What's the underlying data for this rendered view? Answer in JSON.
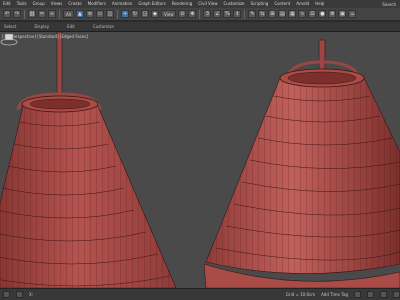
{
  "menubar": {
    "items": [
      "Edit",
      "Tools",
      "Group",
      "Views",
      "Create",
      "Modifiers",
      "Animation",
      "Graph Editors",
      "Rendering",
      "Civil View",
      "Customize",
      "Scripting",
      "Content",
      "Arnold",
      "Help"
    ],
    "search_label": "Search"
  },
  "toolbar": {
    "dropdown_label": "All",
    "view_label": "View"
  },
  "subbar": {
    "items": [
      "Select",
      "Display",
      "Edit",
      "Customize"
    ]
  },
  "viewport": {
    "label": "[+] [Perspective] [Standard] [Edged Faces]"
  },
  "statusbar": {
    "x_label": "X:",
    "grid_label": "Grid = 10,0cm",
    "add_time_tag": "Add Time Tag"
  },
  "colors": {
    "mesh_fill": "#b5534f",
    "mesh_dark": "#8f3b38",
    "wire": "#3a1414",
    "viewport_bg": "#4a4a4a",
    "pole": "#9a4643"
  }
}
